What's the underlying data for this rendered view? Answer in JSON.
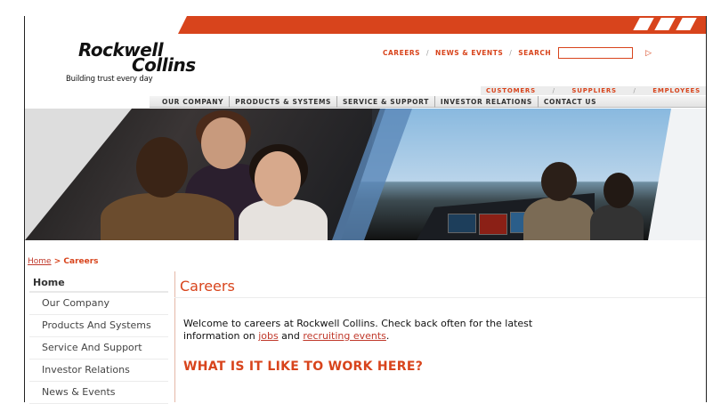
{
  "brand": {
    "name_line1": "Rockwell",
    "name_line2": "Collins",
    "tagline": "Building trust every day",
    "accent_color": "#d8441c"
  },
  "top_nav": {
    "careers": "CAREERS",
    "news_events": "NEWS & EVENTS",
    "search_label": "SEARCH",
    "search_value": "",
    "go_icon": "play-arrow-icon",
    "sep": "/"
  },
  "audience_nav": {
    "customers": "CUSTOMERS",
    "suppliers": "SUPPLIERS",
    "employees": "EMPLOYEES",
    "sep": "/"
  },
  "main_nav": {
    "items": [
      "OUR COMPANY",
      "PRODUCTS & SYSTEMS",
      "SERVICE & SUPPORT",
      "INVESTOR RELATIONS",
      "CONTACT US"
    ]
  },
  "breadcrumb": {
    "home": "Home",
    "sep": " > ",
    "current": "Careers"
  },
  "sidebar": {
    "home": "Home",
    "items": [
      "Our Company",
      "Products And Systems",
      "Service And Support",
      "Investor Relations",
      "News & Events"
    ]
  },
  "content": {
    "title": "Careers",
    "body_pre": "Welcome to careers at Rockwell Collins. Check back often for the latest information on ",
    "link_jobs": "jobs",
    "body_mid": " and ",
    "link_events": "recruiting events",
    "body_post": ".",
    "heading": "WHAT IS IT LIKE TO WORK HERE?"
  }
}
